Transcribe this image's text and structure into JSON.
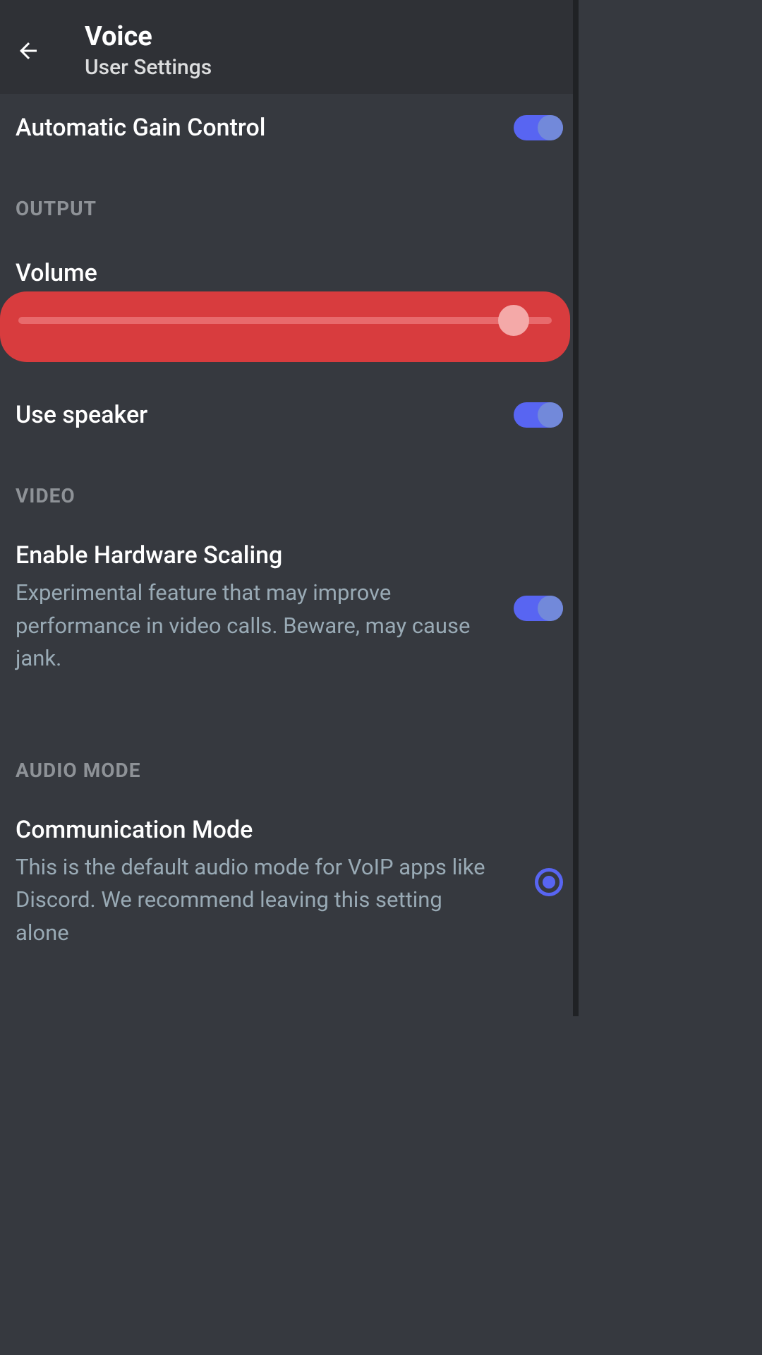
{
  "header": {
    "title": "Voice",
    "subtitle": "User Settings"
  },
  "settings": {
    "automaticGainControl": {
      "label": "Automatic Gain Control",
      "enabled": true
    },
    "output": {
      "sectionLabel": "OUTPUT",
      "volume": {
        "label": "Volume",
        "value": 90
      },
      "useSpeaker": {
        "label": "Use speaker",
        "enabled": true
      }
    },
    "video": {
      "sectionLabel": "VIDEO",
      "hardwareScaling": {
        "label": "Enable Hardware Scaling",
        "description": "Experimental feature that may improve performance in video calls. Beware, may cause jank.",
        "enabled": true
      }
    },
    "audioMode": {
      "sectionLabel": "AUDIO MODE",
      "communicationMode": {
        "label": "Communication Mode",
        "description": "This is the default audio mode for VoIP apps like Discord. We recommend leaving this setting alone",
        "selected": true
      }
    }
  }
}
